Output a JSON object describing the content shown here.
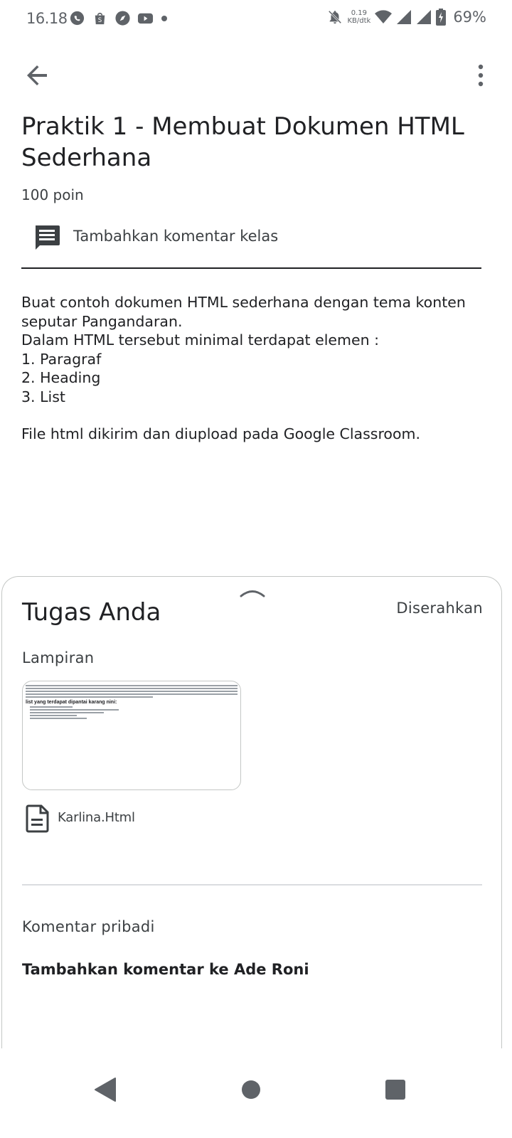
{
  "status_bar": {
    "time": "16.18",
    "net_speed_value": "0.19",
    "net_speed_unit": "KB/dtk",
    "battery": "69%",
    "left_icons": [
      "whatsapp-icon",
      "shopee-icon",
      "compass-icon",
      "youtube-icon",
      "dot-icon"
    ],
    "right_icons": [
      "notifications-off-icon",
      "wifi-icon",
      "signal-icon",
      "signal-icon",
      "battery-charging-icon"
    ]
  },
  "toolbar": {
    "back_icon": "arrow-back-icon",
    "more_icon": "more-vert-icon"
  },
  "assignment": {
    "title": "Praktik 1 - Membuat Dokumen HTML Sederhana",
    "points": "100 poin",
    "class_comment_placeholder": "Tambahkan komentar kelas",
    "description_lines": [
      "Buat contoh dokumen HTML sederhana dengan tema konten seputar Pangandaran.",
      "Dalam HTML tersebut minimal terdapat elemen :",
      "1. Paragraf",
      "2. Heading",
      "3. List",
      "",
      "File html dikirim dan diupload pada Google Classroom."
    ]
  },
  "your_work": {
    "title": "Tugas Anda",
    "status": "Diserahkan",
    "attachments_label": "Lampiran",
    "attachment": {
      "preview_heading": "list yang terdapat dipantai karang nini:",
      "file_name": "Karlina.Html"
    },
    "private_comments_label": "Komentar pribadi",
    "add_private_comment": "Tambahkan komentar ke Ade Roni"
  },
  "nav_bar": {
    "buttons": [
      "back-triangle-icon",
      "home-circle-icon",
      "recents-square-icon"
    ]
  },
  "colors": {
    "text_primary": "#202124",
    "text_secondary": "#3c4043",
    "icon_gray": "#5f6368",
    "divider": "#dadce0"
  }
}
